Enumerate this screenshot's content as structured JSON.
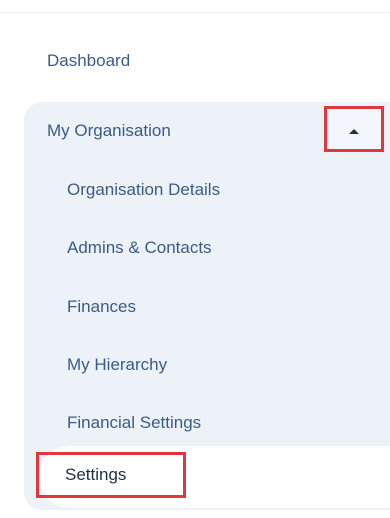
{
  "sidebar": {
    "dashboard_label": "Dashboard",
    "group": {
      "label": "My Organisation",
      "collapse_icon": "chevron-up-icon",
      "items": [
        {
          "label": "Organisation Details"
        },
        {
          "label": "Admins & Contacts"
        },
        {
          "label": "Finances"
        },
        {
          "label": "My Hierarchy"
        },
        {
          "label": "Financial Settings"
        },
        {
          "label": "Settings",
          "active": true
        }
      ]
    }
  },
  "colors": {
    "link_text": "#3b5b87",
    "active_text": "#1e2f45",
    "group_background": "#edf2f8",
    "highlight_border": "#e2363d"
  }
}
